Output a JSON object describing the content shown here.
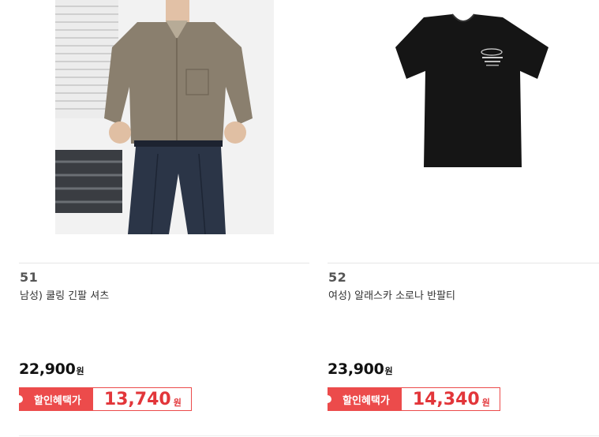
{
  "products": [
    {
      "rank": "51",
      "name": "남성) 쿨링 긴팔 셔츠",
      "price": "22,900",
      "currency": "원",
      "discount_label": "할인혜택가",
      "discount_price": "13,740",
      "image": "model wearing khaki long-sleeve shirt and navy trousers"
    },
    {
      "rank": "52",
      "name": "여성) 알래스카 소로나 반팔티",
      "price": "23,900",
      "currency": "원",
      "discount_label": "할인혜택가",
      "discount_price": "14,340",
      "image": "black short-sleeve t-shirt with small white chest print"
    }
  ],
  "colors": {
    "discount": "#ec4b4b",
    "divider": "#e6e6e6"
  }
}
